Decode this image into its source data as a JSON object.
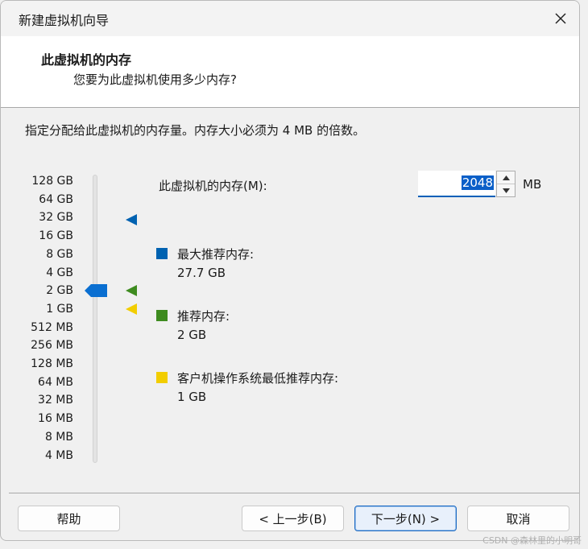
{
  "window": {
    "title": "新建虚拟机向导"
  },
  "header": {
    "title": "此虚拟机的内存",
    "subtitle": "您要为此虚拟机使用多少内存?"
  },
  "instruction": "指定分配给此虚拟机的内存量。内存大小必须为 4 MB 的倍数。",
  "scale": {
    "labels": [
      "128 GB",
      "64 GB",
      "32 GB",
      "16 GB",
      "8 GB",
      "4 GB",
      "2 GB",
      "1 GB",
      "512 MB",
      "256 MB",
      "128 MB",
      "64 MB",
      "32 MB",
      "16 MB",
      "8 MB",
      "4 MB"
    ],
    "current_index": 6
  },
  "memory": {
    "label": "此虚拟机的内存(M):",
    "value": "2048",
    "unit": "MB"
  },
  "legend": {
    "max": {
      "label": "最大推荐内存:",
      "value": "27.7 GB",
      "color": "#0062b1",
      "marker_index": 2.1
    },
    "recommended": {
      "label": "推荐内存:",
      "value": "2 GB",
      "color": "#3e8b1f",
      "marker_index": 6
    },
    "minimum": {
      "label": "客户机操作系统最低推荐内存:",
      "value": "1 GB",
      "color": "#f2cd00",
      "marker_index": 7
    }
  },
  "buttons": {
    "help": "帮助",
    "back": "< 上一步(B)",
    "next": "下一步(N) >",
    "cancel": "取消"
  },
  "watermark": "CSDN @森林里的小明哥"
}
